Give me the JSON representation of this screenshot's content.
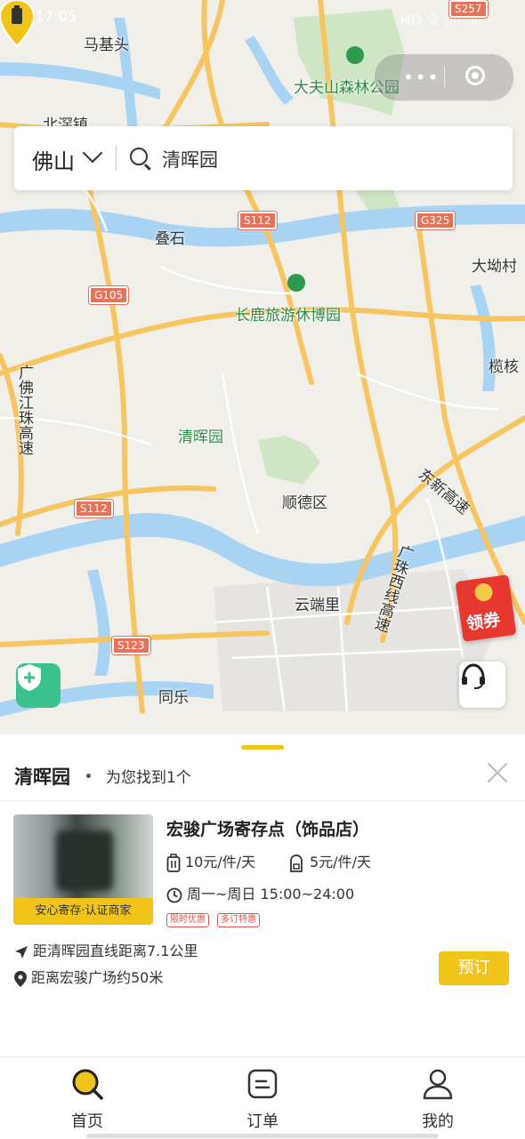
{
  "status_bar": {
    "time": "17:05",
    "signal_text": "HD 令 .ııl .ııl"
  },
  "map": {
    "labels": {
      "majitou": "马基头",
      "beijiao": "北滘镇",
      "dafushan": "大夫山森林公园",
      "dieshi": "叠石",
      "changlu": "长鹿旅游休博园",
      "dawucun": "大坳村",
      "lanhe": "榄核",
      "guangfo": "广佛江珠高速",
      "qinghuiyuan": "清晖园",
      "shunde": "顺德区",
      "dongxin": "东新高速",
      "guangzhuxi": "广珠西线高速",
      "yunduanli": "云端里",
      "tongle": "同乐"
    },
    "road_badges": {
      "s257": "S257",
      "s112a": "S112",
      "g325": "G325",
      "g105": "G105",
      "s112b": "S112",
      "s123": "S123"
    },
    "coupon_label": "领券"
  },
  "search": {
    "city": "佛山",
    "query": "清晖园"
  },
  "sheet": {
    "title": "清晖园",
    "found_text": "为您找到1个",
    "store": {
      "badge": "安心寄存·认证商家",
      "name": "宏骏广场寄存点（饰品店）",
      "price_large": "10元/件/天",
      "price_small": "5元/件/天",
      "hours": "周一~周日 15:00~24:00",
      "tags": [
        "限时优惠",
        "多订特惠"
      ],
      "distance_line": "距清晖园直线距离7.1公里",
      "location_line": "距离宏骏广场约50米",
      "book_label": "预订"
    }
  },
  "tabbar": [
    {
      "label": "首页",
      "icon": "search-icon"
    },
    {
      "label": "订单",
      "icon": "order-icon"
    },
    {
      "label": "我的",
      "icon": "user-icon"
    }
  ],
  "colors": {
    "accent": "#f0c419",
    "pin_blue": "#1e8ad6",
    "shield_green": "#3ac18d",
    "coupon_red": "#e6382f"
  }
}
